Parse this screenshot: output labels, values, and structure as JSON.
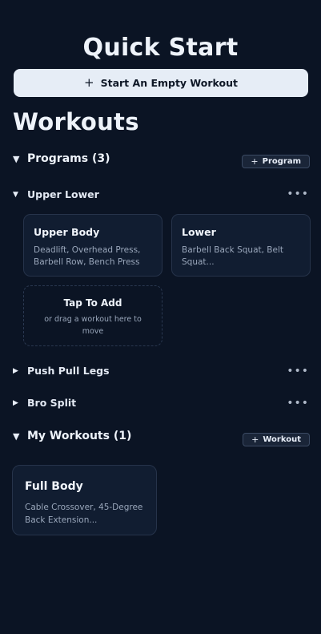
{
  "quick_start": {
    "title": "Quick Start",
    "button_label": "Start An Empty Workout",
    "button_icon": "plus-icon"
  },
  "workouts": {
    "title": "Workouts"
  },
  "programs_section": {
    "label": "Programs (3)",
    "add_button_label": "Program",
    "expanded": true
  },
  "programs": [
    {
      "name": "Upper Lower",
      "expanded": true,
      "workouts": [
        {
          "title": "Upper Body",
          "exercises": "Deadlift, Overhead Press, Barbell Row, Bench Press"
        },
        {
          "title": "Lower",
          "exercises": "Barbell Back Squat, Belt Squat..."
        }
      ],
      "drop_zone": {
        "title": "Tap To Add",
        "hint": "or drag a workout here to move"
      }
    },
    {
      "name": "Push Pull Legs",
      "expanded": false
    },
    {
      "name": "Bro Split",
      "expanded": false
    }
  ],
  "my_workouts_section": {
    "label": "My Workouts (1)",
    "add_button_label": "Workout",
    "expanded": true
  },
  "my_workouts": [
    {
      "title": "Full Body",
      "exercises": "Cable Crossover, 45-Degree Back Extension..."
    }
  ],
  "colors": {
    "background": "#0b1424",
    "card": "#111d31",
    "card_border": "#26334a",
    "primary_button": "#e6edf6",
    "muted_text": "#9aa7bb"
  }
}
